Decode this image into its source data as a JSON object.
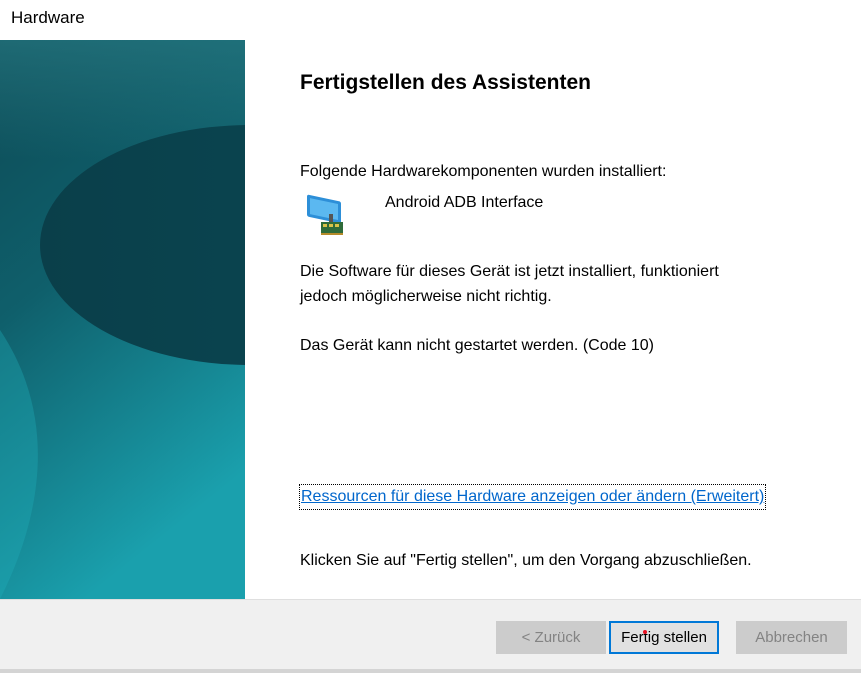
{
  "window": {
    "title": "Hardware"
  },
  "wizard": {
    "heading": "Fertigstellen des Assistenten",
    "installed_label": "Folgende Hardwarekomponenten wurden installiert:",
    "device_name": "Android ADB Interface",
    "device_icon": "network-adapter-icon",
    "software_line1": "Die Software für dieses Gerät ist jetzt installiert, funktioniert",
    "software_line2": "jedoch möglicherweise nicht richtig.",
    "status_message": "Das Gerät kann nicht gestartet werden. (Code 10)",
    "resources_link": "Ressourcen für diese Hardware anzeigen oder ändern (Erweitert)",
    "finish_instruction": "Klicken Sie auf \"Fertig stellen\", um den Vorgang abzuschließen."
  },
  "buttons": {
    "back": "< Zurück",
    "finish": "Fertig stellen",
    "cancel": "Abbrechen"
  },
  "colors": {
    "link": "#0066cc",
    "focus_border": "#0078d7",
    "banner_dark": "#0a3f4d",
    "banner_light": "#1ba5b0"
  }
}
